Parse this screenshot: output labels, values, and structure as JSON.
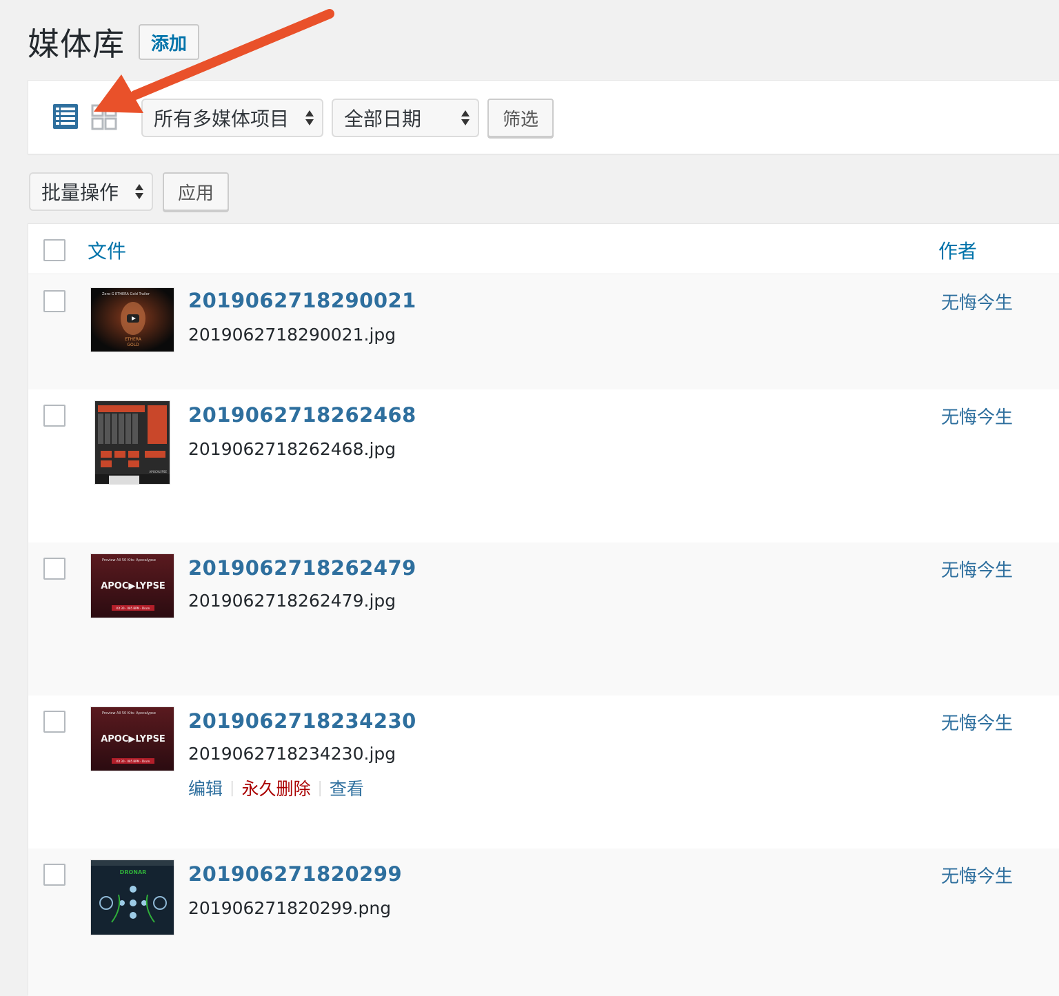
{
  "header": {
    "title": "媒体库",
    "add_label": "添加"
  },
  "filters": {
    "type_selected": "所有多媒体项目",
    "date_selected": "全部日期",
    "filter_label": "筛选"
  },
  "bulk": {
    "action_selected": "批量操作",
    "apply_label": "应用"
  },
  "table": {
    "headers": {
      "file": "文件",
      "author": "作者"
    },
    "rows": [
      {
        "title": "2019062718290021",
        "filename": "2019062718290021.jpg",
        "author": "无悔今生",
        "thumb": "video-dark"
      },
      {
        "title": "2019062718262468",
        "filename": "2019062718262468.jpg",
        "author": "无悔今生",
        "thumb": "mixer"
      },
      {
        "title": "2019062718262479",
        "filename": "2019062718262479.jpg",
        "author": "无悔今生",
        "thumb": "apocalypse"
      },
      {
        "title": "2019062718234230",
        "filename": "2019062718234230.jpg",
        "author": "无悔今生",
        "thumb": "apocalypse"
      },
      {
        "title": "201906271820299",
        "filename": "201906271820299.png",
        "author": "无悔今生",
        "thumb": "dronar"
      }
    ],
    "row_actions": {
      "edit": "编辑",
      "delete": "永久删除",
      "view": "查看"
    }
  },
  "thumb_text": {
    "video_title": "Zero-G ETHERA Gold Trailer",
    "ethera_line1": "ETHERA",
    "ethera_line2": "GOLD",
    "apoc_header": "Preview All 50 Kits: Apocalypse",
    "apoc_main": "APOC▶LYPSE",
    "apoc_sub": "Kit 30 - 085 BPM - Drum",
    "mixer_brand": "APOCALYPSE",
    "dronar_title": "DRONAR"
  },
  "colors": {
    "link": "#0073aa",
    "delete": "#aa0000",
    "annotation_arrow": "#e9512a"
  }
}
